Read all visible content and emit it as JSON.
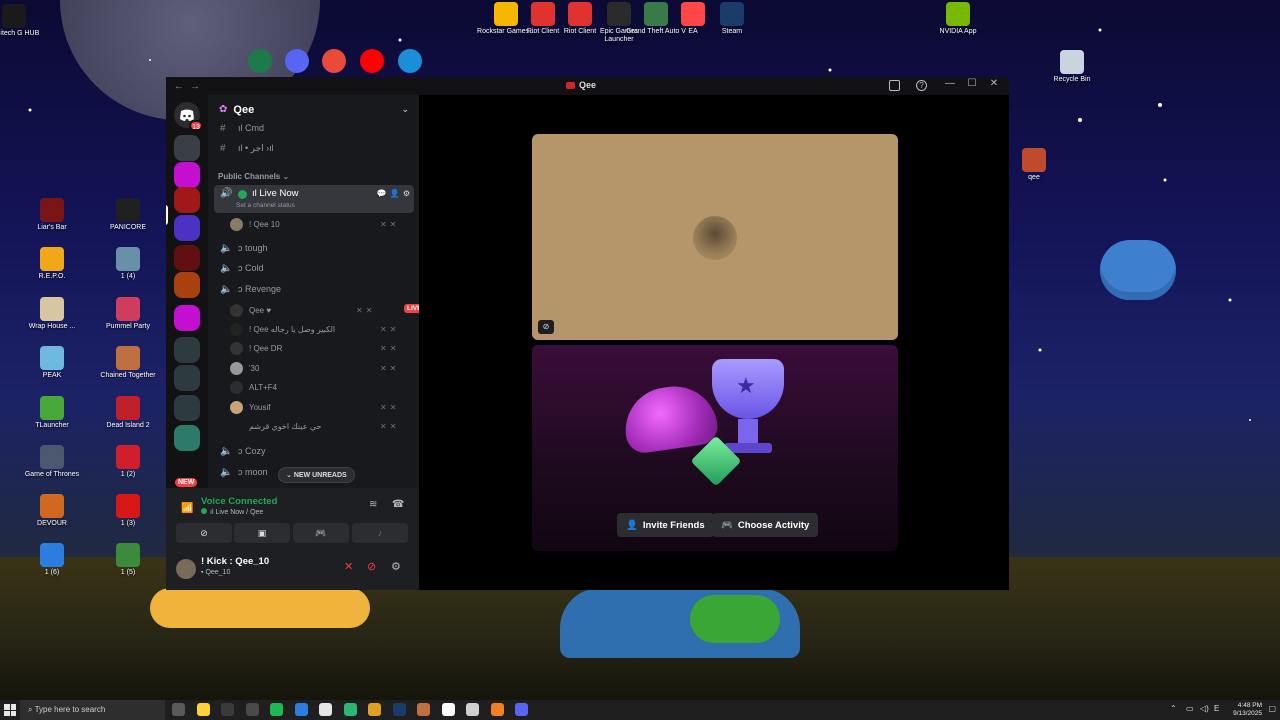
{
  "desktop": {
    "icons": [
      {
        "label": "Logitech G HUB",
        "color": "#1a1a1a"
      },
      {
        "label": "Rockstar Games...",
        "color": "#f7b600"
      },
      {
        "label": "Riot Client",
        "color": "#e0322e"
      },
      {
        "label": "Riot Client",
        "color": "#e0322e"
      },
      {
        "label": "Epic Games Launcher",
        "color": "#2a2a2a"
      },
      {
        "label": "Grand Theft Auto V",
        "color": "#3a7a4a"
      },
      {
        "label": "EA",
        "color": "#ff4747"
      },
      {
        "label": "Steam",
        "color": "#1b3c6b"
      },
      {
        "label": "NVIDIA App",
        "color": "#76b900"
      },
      {
        "label": "Recycle Bin",
        "color": "#c9d4e0"
      },
      {
        "label": "qee",
        "color": "#c04a2c"
      },
      {
        "label": "Liar's Bar",
        "color": "#7a1515"
      },
      {
        "label": "PANICORE",
        "color": "#202020"
      },
      {
        "label": "R.E.P.O.",
        "color": "#f0a818"
      },
      {
        "label": "1 (4)",
        "color": "#6a8fa8"
      },
      {
        "label": "Wrap House ...",
        "color": "#d8c6a0"
      },
      {
        "label": "Pummel Party",
        "color": "#d03c5c"
      },
      {
        "label": "PEAK",
        "color": "#6fb8e0"
      },
      {
        "label": "Chained Together",
        "color": "#c07040"
      },
      {
        "label": "TLauncher",
        "color": "#4aa83a"
      },
      {
        "label": "Dead Island 2",
        "color": "#c0202a"
      },
      {
        "label": "Game of Thrones",
        "color": "#4b5870"
      },
      {
        "label": "1 (2)",
        "color": "#d01e2c"
      },
      {
        "label": "1 (1)",
        "color": "#1a1a1a"
      },
      {
        "label": "DEVOUR",
        "color": "#d06820"
      },
      {
        "label": "1 (3)",
        "color": "#d81818"
      },
      {
        "label": "1 (6)",
        "color": "#2b7de0"
      },
      {
        "label": "1 (5)",
        "color": "#3c8a3c"
      }
    ]
  },
  "window": {
    "title": "Qee",
    "nav_back": "←",
    "nav_forward": "→",
    "minimize": "—",
    "maximize": "☐",
    "close": "✕",
    "help": "?"
  },
  "rail": {
    "dm_badge": "13",
    "new_label": "NEW",
    "server_colors": [
      "#3a3f45",
      "#c20fd0",
      "#a01818",
      "#4b32c3",
      "#601010",
      "#a84010",
      "#c20fd0",
      "#2d3a40",
      "#2d3a40",
      "#2d3a40",
      "#2d7a6a"
    ],
    "badges": {
      "s1": "13",
      "s2": "6"
    }
  },
  "server": {
    "name": "Qee",
    "channels_top": [
      {
        "name": "ıl Cmd"
      },
      {
        "name": "ıl • اجر ›ıl"
      }
    ],
    "category": "Public Channels",
    "active_channel": {
      "name": "ıl Live Now",
      "status": "Set a channel status"
    },
    "active_users": [
      {
        "name": "! Qee 10"
      }
    ],
    "voice_channels": [
      {
        "name": "ↄ tough"
      },
      {
        "name": "ↄ Cold"
      },
      {
        "name": "ↄ Revenge"
      }
    ],
    "revenge_users": [
      {
        "name": "Qee ♥",
        "live": "LIVE"
      },
      {
        "name": "! Qee الكبير وصل يا رجاله"
      },
      {
        "name": "! Qee DR"
      },
      {
        "name": "'30"
      },
      {
        "name": "ALT+F4"
      },
      {
        "name": "Yousif"
      },
      {
        "name": "حي عينك اخوي قرشم"
      }
    ],
    "bottom_channels": [
      {
        "name": "ↄ Cozy"
      },
      {
        "name": "ↄ moon"
      }
    ],
    "new_unreads": "NEW UNREADS"
  },
  "voice": {
    "status": "Voice Connected",
    "channel": "ıl Live Now / Qee",
    "user_name": "! Kick : Qee_10",
    "user_sub": "Qee_10"
  },
  "stage": {
    "invite_label": "Invite Friends",
    "activity_label": "Choose Activity"
  },
  "taskbar": {
    "search_placeholder": "Type here to search",
    "time": "4:48 PM",
    "date": "9/13/2025",
    "app_colors": [
      "#5a5a5a",
      "#ffd23a",
      "#3a3a3a",
      "#4a4a4a",
      "#1db954",
      "#2b7de0",
      "#e6e6e6",
      "#2bb673",
      "#e0a020",
      "#1b3c6b",
      "#c07040",
      "#ffffff",
      "#cfcfcf",
      "#f08020",
      "#5865f2"
    ]
  }
}
